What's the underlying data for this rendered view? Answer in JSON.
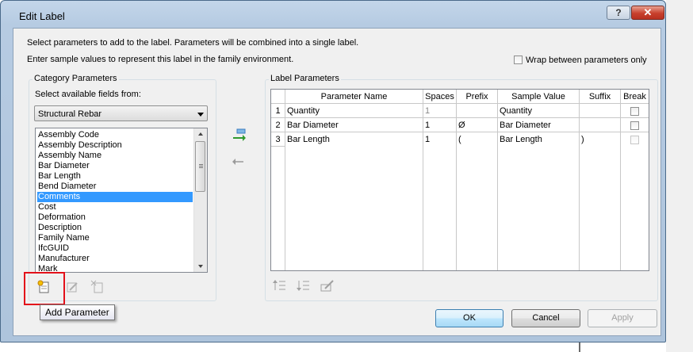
{
  "window": {
    "title": "Edit Label",
    "help_label": "?",
    "close_label": "✕"
  },
  "intro": {
    "line1": "Select parameters to add to the label.  Parameters will be combined into a single label.",
    "line2": "Enter sample values to represent this label in the family environment."
  },
  "wrap": {
    "label": "Wrap between parameters only",
    "checked": false
  },
  "category": {
    "group_label": "Category Parameters",
    "fields_label": "Select available fields from:",
    "selected_source": "Structural Rebar",
    "items": [
      "Assembly Code",
      "Assembly Description",
      "Assembly Name",
      "Bar Diameter",
      "Bar Length",
      "Bend Diameter",
      "Comments",
      "Cost",
      "Deformation",
      "Description",
      "Family Name",
      "IfcGUID",
      "Manufacturer",
      "Mark"
    ],
    "selected_item": "Comments"
  },
  "tooltip": {
    "text": "Add Parameter"
  },
  "label_params": {
    "group_label": "Label Parameters",
    "columns": [
      "",
      "Parameter Name",
      "Spaces",
      "Prefix",
      "Sample Value",
      "Suffix",
      "Break"
    ],
    "rows": [
      {
        "num": "1",
        "name": "Quantity",
        "spaces": "1",
        "prefix": "",
        "sample": "Quantity",
        "suffix": "",
        "break": false
      },
      {
        "num": "2",
        "name": "Bar Diameter",
        "spaces": "1",
        "prefix": "Ø",
        "sample": "Bar Diameter",
        "suffix": "",
        "break": false
      },
      {
        "num": "3",
        "name": "Bar Length",
        "spaces": "1",
        "prefix": "(",
        "sample": "Bar Length",
        "suffix": ")",
        "break": false
      }
    ]
  },
  "icons": {
    "add_parameter": "add-parameter-icon",
    "edit_parameter": "edit-parameter-icon",
    "remove_parameter": "remove-parameter-icon",
    "add_to_label": "add-to-label-arrow-icon",
    "remove_from_label": "remove-from-label-arrow-icon",
    "move_up": "move-up-icon",
    "move_down": "move-down-icon",
    "edit_sample": "edit-sample-icon"
  },
  "buttons": {
    "ok": "OK",
    "cancel": "Cancel",
    "apply": "Apply"
  },
  "colors": {
    "selection": "#3399ff",
    "highlight_box": "#e3101a",
    "default_button_border": "#3c7fb1"
  }
}
